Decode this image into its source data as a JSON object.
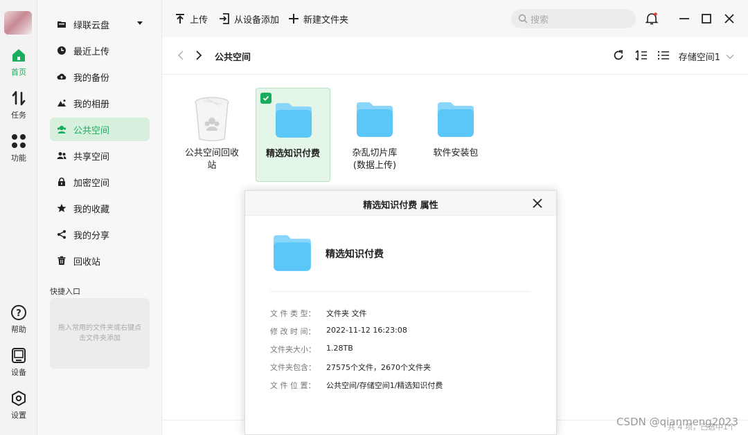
{
  "rail": {
    "items": [
      {
        "label": "首页"
      },
      {
        "label": "任务"
      },
      {
        "label": "功能"
      },
      {
        "label": "帮助"
      },
      {
        "label": "设备"
      },
      {
        "label": "设置"
      }
    ],
    "accent": "#1aad5e"
  },
  "sidebar": {
    "items": [
      {
        "label": "绿联云盘"
      },
      {
        "label": "最近上传"
      },
      {
        "label": "我的备份"
      },
      {
        "label": "我的相册"
      },
      {
        "label": "公共空间"
      },
      {
        "label": "共享空间"
      },
      {
        "label": "加密空间"
      },
      {
        "label": "我的收藏"
      },
      {
        "label": "我的分享"
      },
      {
        "label": "回收站"
      }
    ],
    "quick_title": "快捷入口",
    "quick_hint": "拖入常用的文件夹或右键点击文件夹添加"
  },
  "toolbar": {
    "upload": "上传",
    "add_from_device": "从设备添加",
    "new_folder": "新建文件夹",
    "search_placeholder": "搜索"
  },
  "breadcrumb": {
    "title": "公共空间",
    "storage": "存储空间1"
  },
  "files": [
    {
      "name": "公共空间回收站"
    },
    {
      "name": "精选知识付费"
    },
    {
      "name": "杂乱切片库(数据上传)"
    },
    {
      "name": "软件安装包"
    }
  ],
  "dialog": {
    "title": "精选知识付费 属性",
    "name": "精选知识付费",
    "props": [
      {
        "key": "文 件 类 型：",
        "value": "文件夹 文件"
      },
      {
        "key": "修 改 时 间：",
        "value": "2022-11-12 16:23:08"
      },
      {
        "key": "文件夹大小：",
        "value": "1.28TB"
      },
      {
        "key": "文件夹包含：",
        "value": "27575个文件，2670个文件夹"
      },
      {
        "key": "文 件 位 置：",
        "value": "公共空间/存储空间1/精选知识付费"
      }
    ]
  },
  "status": "共 4 项，已选中1个",
  "watermark": "CSDN @qianmeng2023",
  "colors": {
    "folder": "#5bc6f8",
    "folder_back": "#8ad6fb",
    "selected_bg": "#e4f6e8"
  }
}
